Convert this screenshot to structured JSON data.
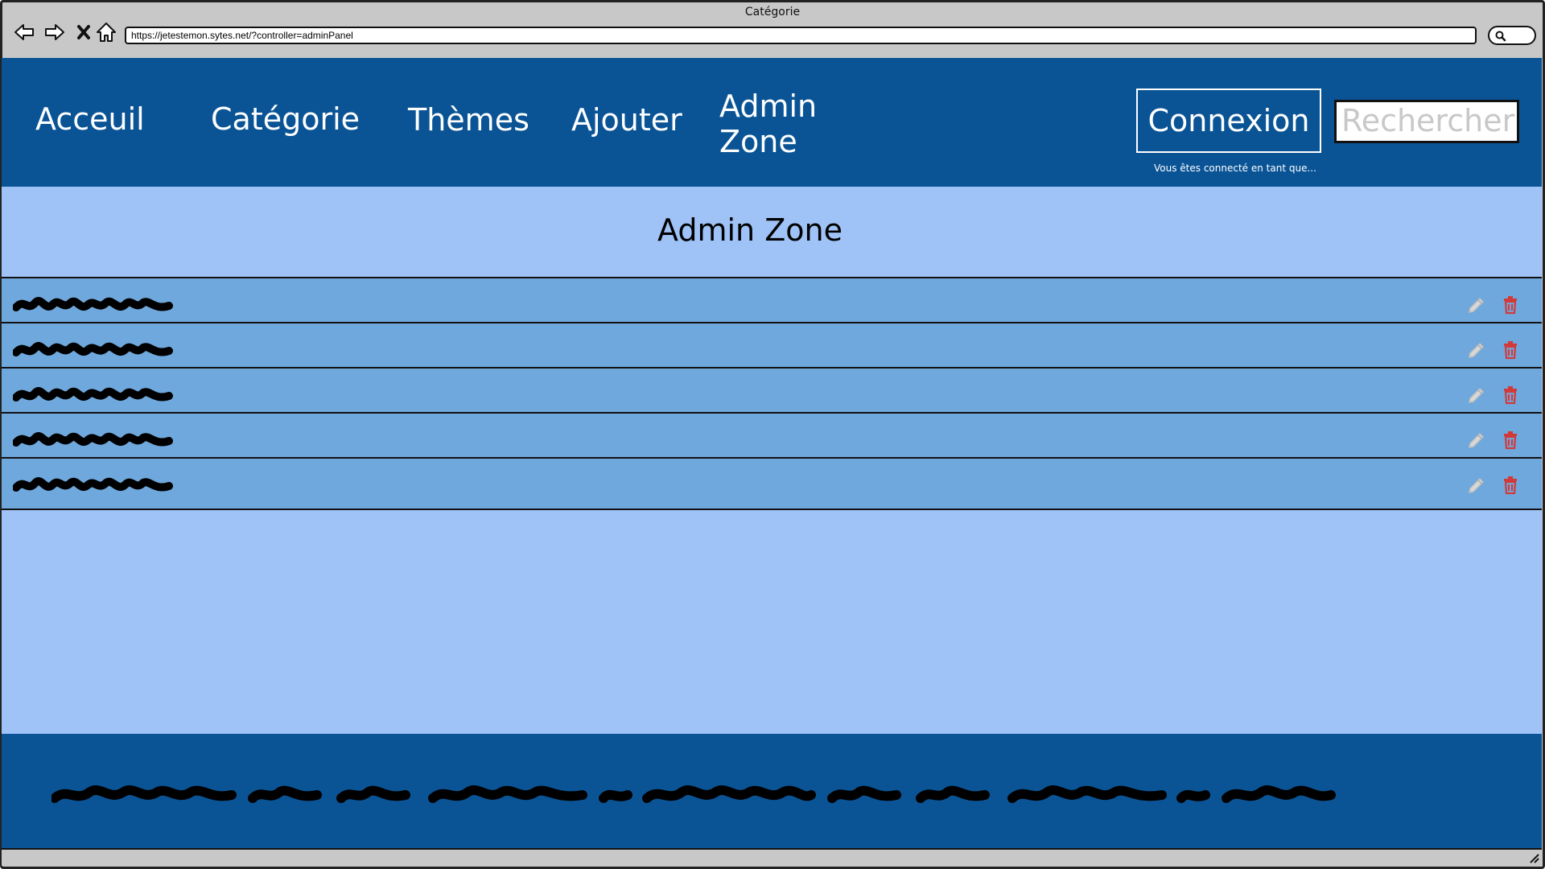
{
  "browser": {
    "window_title": "Catégorie",
    "url": "https://jetestemon.sytes.net/?controller=adminPanel",
    "icons": [
      "back-arrow-icon",
      "forward-arrow-icon",
      "close-x-icon",
      "home-icon",
      "search-icon"
    ]
  },
  "header": {
    "nav": [
      "Acceuil",
      "Catégorie",
      "Thèmes",
      "Ajouter",
      "Admin Zone"
    ],
    "admin_zone_line1": "Admin",
    "admin_zone_line2": "Zone",
    "login_label": "Connexion",
    "search_placeholder": "Rechercher",
    "connected_status": "Vous êtes connecté en tant que..."
  },
  "main": {
    "title": "Admin Zone",
    "rows": [
      {
        "label": "[scribbled text]",
        "edit_icon": "pencil-icon",
        "delete_icon": "trash-icon"
      },
      {
        "label": "[scribbled text]",
        "edit_icon": "pencil-icon",
        "delete_icon": "trash-icon"
      },
      {
        "label": "[scribbled text]",
        "edit_icon": "pencil-icon",
        "delete_icon": "trash-icon"
      },
      {
        "label": "[scribbled text]",
        "edit_icon": "pencil-icon",
        "delete_icon": "trash-icon"
      },
      {
        "label": "[scribbled text]",
        "edit_icon": "pencil-icon",
        "delete_icon": "trash-icon"
      }
    ]
  },
  "footer": {
    "text": "[scribbled placeholder text]"
  },
  "colors": {
    "header_bg": "#0a5496",
    "content_bg": "#9fc3f7",
    "row_bg": "#6fa8dc",
    "delete_red": "#d23a3a",
    "edit_gray": "#d8d8d8"
  }
}
